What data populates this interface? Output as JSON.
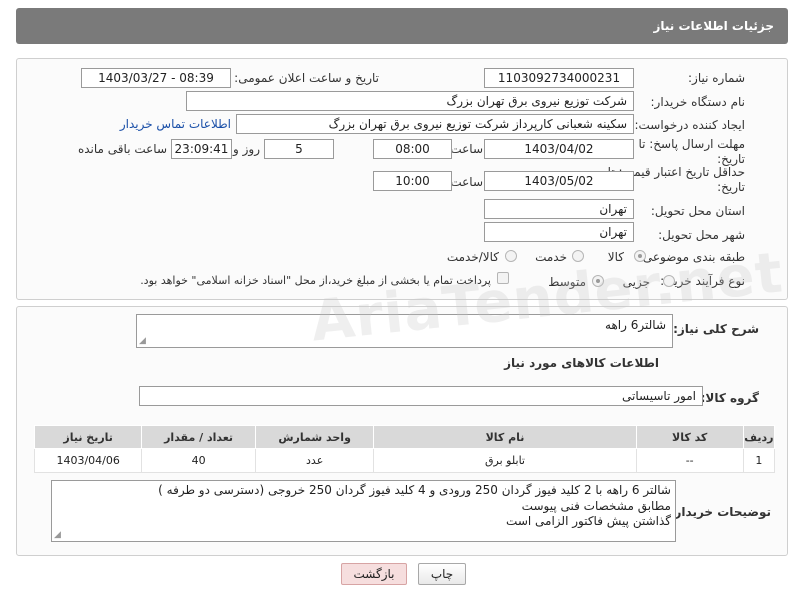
{
  "header": {
    "title": "جزئیات اطلاعات نیاز"
  },
  "form": {
    "need_number": {
      "label": "شماره نیاز:",
      "value": "1103092734000231"
    },
    "announce": {
      "label": "تاریخ و ساعت اعلان عمومی:",
      "value": "1403/03/27 - 08:39"
    },
    "buyer_org": {
      "label": "نام دستگاه خریدار:",
      "value": "شرکت توزیع نیروی برق تهران بزرگ"
    },
    "creator": {
      "label": "ایجاد کننده درخواست:",
      "value": "سکینه شعبانی کارپرداز شرکت توزیع نیروی برق تهران بزرگ",
      "contact_link": "اطلاعات تماس خریدار"
    },
    "reply_deadline": {
      "label_line1": "مهلت ارسال پاسخ: تا",
      "label_line2": "تاریخ:",
      "date": "1403/04/02",
      "time_label": "ساعت",
      "time": "08:00",
      "days": "5",
      "days_label": "روز و",
      "remaining": "23:09:41",
      "remaining_label": "ساعت باقی مانده"
    },
    "price_validity": {
      "label_line1": "حداقل تاریخ اعتبار قیمت: تا",
      "label_line2": "تاریخ:",
      "date": "1403/05/02",
      "time_label": "ساعت",
      "time": "10:00"
    },
    "delivery_province": {
      "label": "استان محل تحویل:",
      "value": "تهران"
    },
    "delivery_city": {
      "label": "شهر محل تحویل:",
      "value": "تهران"
    },
    "category": {
      "label": "طبقه بندی موضوعی:",
      "options": [
        "کالا",
        "خدمت",
        "کالا/خدمت"
      ],
      "selected": "کالا"
    },
    "purchase_type": {
      "label": "نوع فرآیند خرید :",
      "options": [
        "جزیی",
        "متوسط"
      ],
      "selected": "متوسط",
      "note": "پرداخت تمام یا بخشی از مبلغ خرید،از محل \"اسناد خزانه اسلامی\" خواهد بود."
    }
  },
  "summary": {
    "label": "شرح کلی نیاز:",
    "value": "شالتر6 راهه"
  },
  "goods": {
    "section_title": "اطلاعات کالاهای مورد نیاز",
    "group_label": "گروه کالا:",
    "group_value": "امور تاسیساتی",
    "columns": [
      "ردیف",
      "کد کالا",
      "نام کالا",
      "واحد شمارش",
      "تعداد / مقدار",
      "تاریخ نیاز"
    ],
    "rows": [
      [
        "1",
        "--",
        "تابلو برق",
        "عدد",
        "40",
        "1403/04/06"
      ]
    ]
  },
  "buyer_notes": {
    "label": "توضیحات خریدار:",
    "lines": [
      "شالتر 6 راهه با 2 کلید فیوز گردان 250 ورودی و 4 کلید فیوز گردان 250 خروجی (دسترسی دو طرفه )",
      "مطابق مشخصات فنی پیوست",
      "گذاشتن پیش فاکتور الزامی است"
    ]
  },
  "buttons": {
    "print": "چاپ",
    "back": "بازگشت"
  },
  "watermark": "AriaTender.net",
  "colors": {
    "header_bg": "#7a7a7a",
    "link": "#1a4fa8",
    "back_btn_bg": "#f6dede"
  }
}
